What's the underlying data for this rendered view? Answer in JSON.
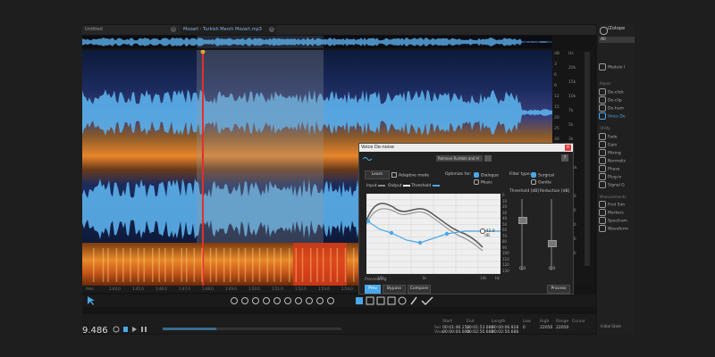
{
  "tabs": [
    {
      "label": "Untitled",
      "active": false
    },
    {
      "label": "Mozart - Turkish March Mozart.mp3",
      "active": true
    }
  ],
  "right_panel": {
    "logo": "iZotope",
    "filter_label": "All",
    "section_repair": "Repair",
    "section_utility": "Utility",
    "section_measurements": "Measurements",
    "items": [
      {
        "label": "Module l",
        "icon": "module-list-icon"
      },
      {
        "label": "De-click",
        "icon": "de-click-icon"
      },
      {
        "label": "De-clip",
        "icon": "de-clip-icon"
      },
      {
        "label": "De-hum",
        "icon": "de-hum-icon"
      },
      {
        "label": "Voice De",
        "icon": "voice-denoise-icon"
      },
      {
        "label": "Fade",
        "icon": "fade-icon"
      },
      {
        "label": "Gain",
        "icon": "gain-icon"
      },
      {
        "label": "Mixing",
        "icon": "mixing-icon"
      },
      {
        "label": "Normaliz",
        "icon": "normalize-icon"
      },
      {
        "label": "Phase",
        "icon": "phase-icon"
      },
      {
        "label": "Plug-in",
        "icon": "plugin-icon"
      },
      {
        "label": "Signal G",
        "icon": "signal-generator-icon"
      },
      {
        "label": "Find Sim",
        "icon": "find-similar-icon"
      },
      {
        "label": "Markers",
        "icon": "markers-icon"
      },
      {
        "label": "Spectrum",
        "icon": "spectrum-icon"
      },
      {
        "label": "Waveform",
        "icon": "waveform-stats-icon"
      }
    ],
    "status": "Initial State"
  },
  "scale": {
    "db_labels": [
      "dB",
      "3",
      "6",
      "9",
      "12",
      "15",
      "20",
      "25",
      "30",
      "inf",
      "25",
      "20",
      "15",
      "12",
      "9",
      "6",
      "3",
      "dB"
    ],
    "hz_labels": [
      "Hz",
      "20k",
      "15k",
      "10k",
      "7k",
      "5k",
      "3k",
      "2k",
      "1.5k",
      "1k",
      "700",
      "500",
      "300",
      "200",
      "100"
    ]
  },
  "ruler": {
    "ticks": [
      "hms",
      "1:44.0",
      "1:45.0",
      "1:46.0",
      "1:47.0",
      "1:48.0",
      "1:49.0",
      "1:50.0",
      "1:51.0",
      "1:52.0",
      "1:53.0",
      "1:54.0",
      "1:55.0",
      "1:56.0",
      "1:57.0",
      "1:58.0",
      "1:59.0",
      "2:00.0",
      "2:01.0",
      "2:02.0"
    ]
  },
  "transport": {
    "timecode": "9.486",
    "start_label": "Start",
    "end_label": "End",
    "length_label": "Length",
    "low_label": "Low",
    "high_label": "High",
    "range_label": "Range",
    "cursor_label": "Cursor",
    "sel_label": "Sel",
    "view_label": "View",
    "start": "00:01:46.152",
    "end": "00:01:53.080",
    "length": "00:00:06.928",
    "low": "0",
    "high": "22050",
    "range": "22050",
    "view_start": "00:00:00.000",
    "view_end": "00:02:50.688",
    "view_length": "00:02:50.688"
  },
  "dialog": {
    "title": "Voice De-noise",
    "preset": "Remove Rumble and H",
    "help": "?",
    "learn": "Learn",
    "adaptive_mode": "Adaptive mode",
    "optimize_for": "Optimize for:",
    "opt_dialogue": "Dialogue",
    "opt_music": "Music",
    "filter_type": "Filter type:",
    "filter_surgical": "Surgical",
    "filter_gentle": "Gentle",
    "legend_input": "Input",
    "legend_output": "Output",
    "legend_threshold": "Threshold",
    "threshold_header": "Threshold [dB]",
    "reduction_header": "Reduction [dB]",
    "threshold_value": "0.0",
    "reduction_value": "0.0",
    "readout": "-42.0 dB",
    "graph_y_labels": [
      "0",
      "10",
      "20",
      "30",
      "40",
      "50",
      "60",
      "70",
      "80",
      "90",
      "100",
      "110",
      "120",
      "130"
    ],
    "graph_x_labels": [
      "100",
      "1k",
      "10k",
      "Hz"
    ],
    "status": "Previewing",
    "preview": "Prev",
    "bypass": "Bypass",
    "compare": "Compare",
    "process": "Process"
  },
  "colors": {
    "accent": "#4aa8e8",
    "playhead": "#e03030",
    "waveform": "#5aaee8",
    "spectrogram_hot": "#e8862a"
  }
}
